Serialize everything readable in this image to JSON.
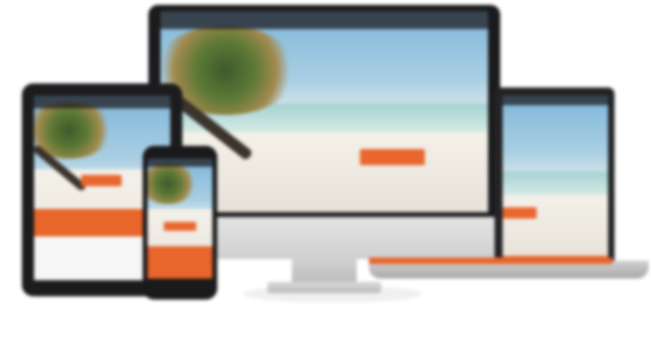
{
  "scene": {
    "devices": [
      {
        "name": "desktop-monitor",
        "has_cta_button": true
      },
      {
        "name": "laptop",
        "has_cta_button": true
      },
      {
        "name": "tablet",
        "has_cta_button": true
      },
      {
        "name": "phone",
        "has_cta_button": true
      }
    ],
    "colors": {
      "accent": "#e9672f",
      "bezel": "#1b1b1d",
      "sky": "#7fb6da",
      "sand": "#f4f1ea"
    },
    "icons": [
      "palm-tree-icon"
    ]
  }
}
